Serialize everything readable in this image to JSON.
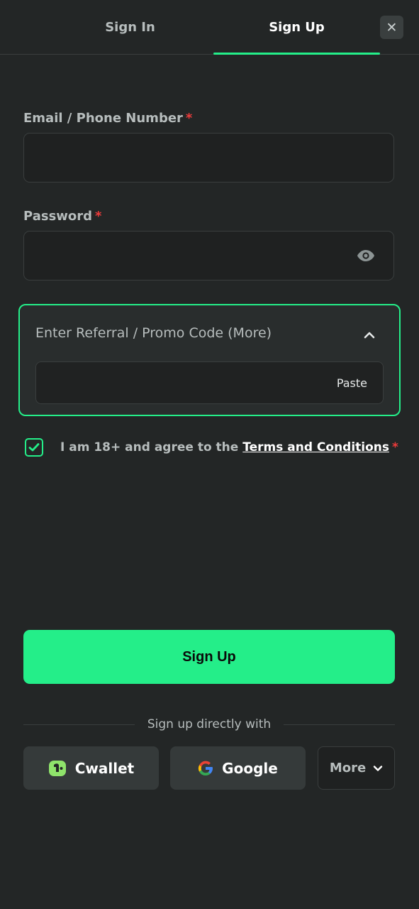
{
  "tabs": {
    "sign_in": "Sign In",
    "sign_up": "Sign Up",
    "active": "Sign Up"
  },
  "close_icon": "close-icon",
  "form": {
    "email_label": "Email / Phone Number",
    "password_label": "Password",
    "required_mark": "*",
    "email_value": "",
    "password_value": "",
    "password_toggle_icon": "eye-icon"
  },
  "promo": {
    "title": "Enter Referral / Promo Code (More)",
    "expanded": true,
    "value": "",
    "paste_label": "Paste"
  },
  "agreement": {
    "checked": true,
    "text": "I am 18+ and agree to the",
    "link": "Terms and Conditions"
  },
  "signup_button": "Sign Up",
  "social": {
    "divider": "Sign up directly with",
    "cwallet": "Cwallet",
    "google": "Google",
    "more": "More"
  },
  "colors": {
    "accent": "#24ee89",
    "background": "#232626",
    "required": "#ee3b3b"
  }
}
